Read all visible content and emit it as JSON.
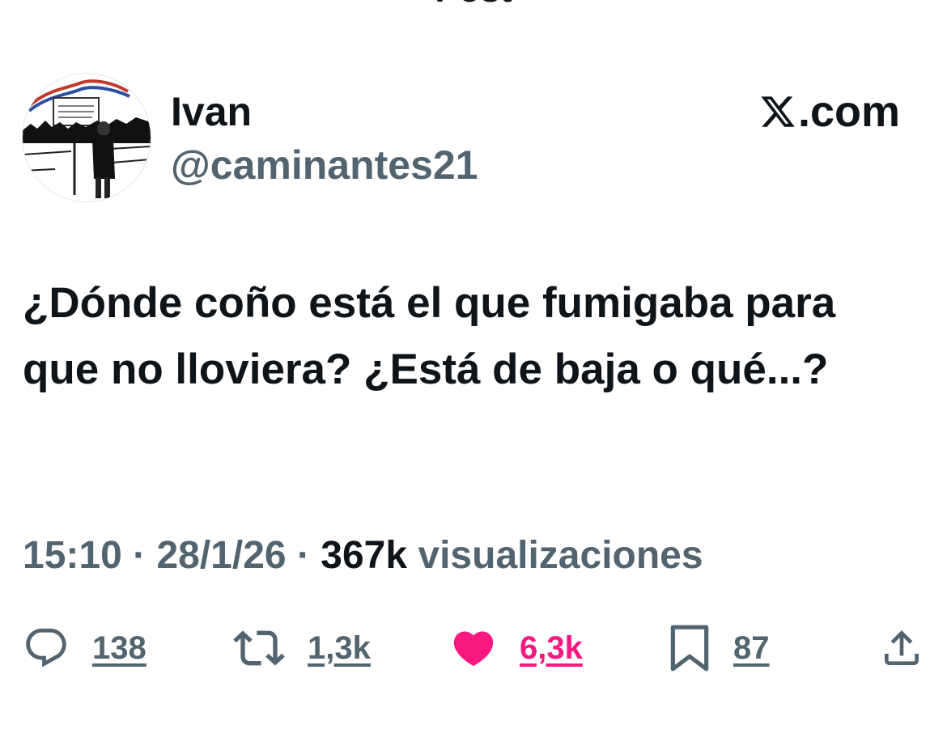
{
  "header": {
    "title": "Post"
  },
  "author": {
    "name": "Ivan",
    "handle": "@caminantes21"
  },
  "brand": {
    "domain": ".com",
    "logo_icon": "x-logo-icon"
  },
  "tweet": {
    "text": "¿Dónde coño está el que fumigaba para que no lloviera? ¿Está de baja o qué...?"
  },
  "meta": {
    "time": "15:10",
    "separator": "·",
    "date": "28/1/26",
    "views_count": "367k",
    "views_label": "visualizaciones"
  },
  "actions": {
    "replies": "138",
    "reposts": "1,3k",
    "likes": "6,3k",
    "bookmarks": "87"
  },
  "colors": {
    "text_primary": "#0f1419",
    "text_secondary": "#536471",
    "like_pink": "#f91880"
  }
}
